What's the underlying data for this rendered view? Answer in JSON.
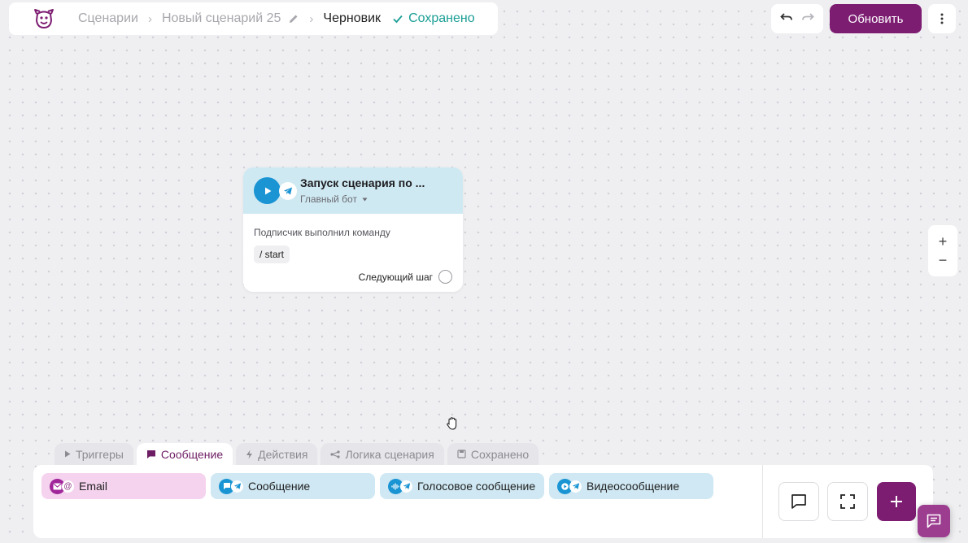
{
  "header": {
    "crumb_scenarios": "Сценарии",
    "crumb_scenario_name": "Новый сценарий 25",
    "crumb_status": "Черновик",
    "saved_label": "Сохранено"
  },
  "actions": {
    "update_label": "Обновить"
  },
  "node": {
    "title": "Запуск сценария по ...",
    "bot_name": "Главный бот",
    "description": "Подписчик выполнил команду",
    "command": "/ start",
    "next_step": "Следующий шаг"
  },
  "zoom": {
    "in": "+",
    "out": "−"
  },
  "tabs": [
    {
      "label": "Триггеры"
    },
    {
      "label": "Сообщение"
    },
    {
      "label": "Действия"
    },
    {
      "label": "Логика сценария"
    },
    {
      "label": "Сохранено"
    }
  ],
  "blocks": [
    {
      "label": "Email"
    },
    {
      "label": "Сообщение"
    },
    {
      "label": "Голосовое сообщение"
    },
    {
      "label": "Видеосообщение"
    }
  ],
  "colors": {
    "brand": "#7d1d72",
    "accent_teal": "#1a9e95",
    "telegram_blue": "#1a94d3",
    "node_header": "#cfe9f3",
    "email_chip": "#f5d3ef"
  },
  "icons": [
    "logo-icon",
    "pencil-icon",
    "check-icon",
    "undo-icon",
    "redo-icon",
    "kebab-icon",
    "play-icon",
    "telegram-icon",
    "hand-cursor-icon",
    "chat-icon",
    "fullscreen-icon",
    "plus-icon",
    "mail-icon",
    "at-icon",
    "message-icon",
    "audio-wave-icon",
    "video-icon",
    "lightning-icon",
    "branch-icon",
    "save-icon",
    "triangle-icon"
  ]
}
